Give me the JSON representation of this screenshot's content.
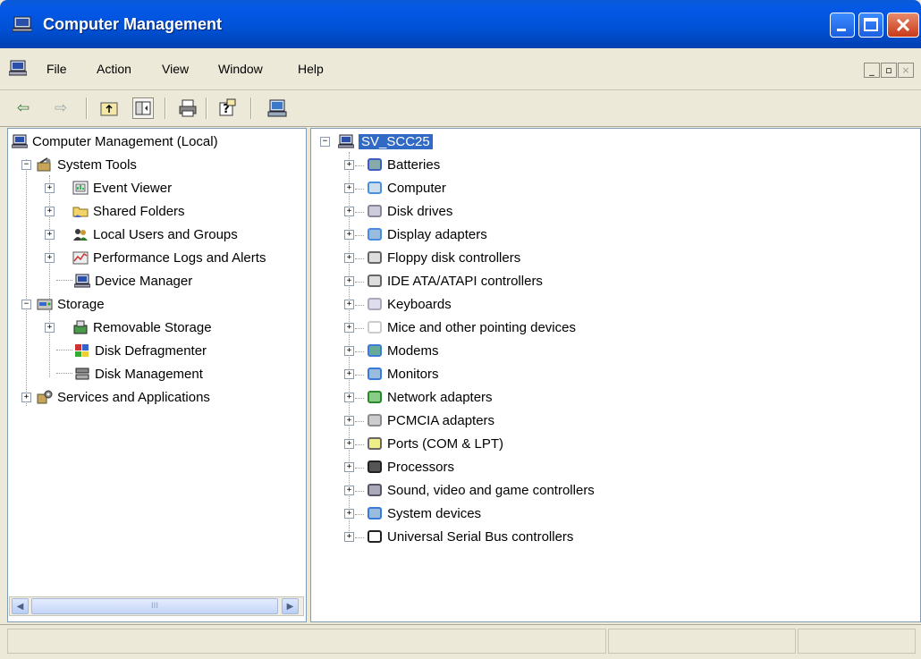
{
  "window": {
    "title": "Computer Management",
    "menu": [
      "File",
      "Action",
      "View",
      "Window",
      "Help"
    ],
    "toolbar_icons": [
      "back-icon",
      "forward-icon",
      "up-folder-icon",
      "show-hide-tree-icon",
      "print-icon",
      "help-icon",
      "properties-icon"
    ]
  },
  "tree": {
    "root": "Computer Management (Local)",
    "system_tools": "System Tools",
    "event_viewer": "Event Viewer",
    "shared_folders": "Shared Folders",
    "local_users": "Local Users and Groups",
    "perf_logs": "Performance Logs and Alerts",
    "device_manager": "Device Manager",
    "storage": "Storage",
    "removable_storage": "Removable Storage",
    "disk_defrag": "Disk Defragmenter",
    "disk_mgmt": "Disk Management",
    "services": "Services and Applications"
  },
  "devices": {
    "computer_name": "SV_SCC25",
    "categories": [
      "Batteries",
      "Computer",
      "Disk drives",
      "Display adapters",
      "Floppy disk controllers",
      "IDE ATA/ATAPI controllers",
      "Keyboards",
      "Mice and other pointing devices",
      "Modems",
      "Monitors",
      "Network adapters",
      "PCMCIA adapters",
      "Ports (COM & LPT)",
      "Processors",
      "Sound, video and game controllers",
      "System devices",
      "Universal Serial Bus controllers"
    ]
  },
  "scrollbar": {
    "thumb_grip": "III"
  }
}
